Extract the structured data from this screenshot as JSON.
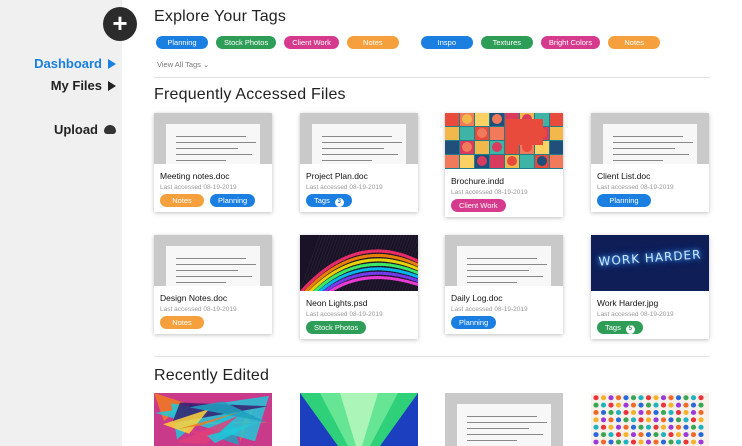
{
  "colors": {
    "blue": "#1a7fe0",
    "green": "#2e9d57",
    "pink": "#d63a8c",
    "orange": "#f5a03c"
  },
  "sidebar": {
    "add_icon": "plus-icon",
    "items": [
      {
        "label": "Dashboard",
        "icon": "play-triangle-icon",
        "active": true
      },
      {
        "label": "My Files",
        "icon": "play-triangle-icon",
        "active": false
      },
      {
        "label": "Upload",
        "icon": "cloud-upload-icon",
        "active": false
      }
    ]
  },
  "tags_section": {
    "title": "Explore Your Tags",
    "tags": [
      {
        "label": "Planning",
        "color": "blue"
      },
      {
        "label": "Stock Photos",
        "color": "green"
      },
      {
        "label": "Client Work",
        "color": "pink"
      },
      {
        "label": "Notes",
        "color": "orange"
      },
      {
        "label": "Inspo",
        "color": "blue"
      },
      {
        "label": "Textures",
        "color": "green"
      },
      {
        "label": "Bright Colors",
        "color": "pink"
      },
      {
        "label": "Notes",
        "color": "orange"
      }
    ],
    "view_all": "View All Tags"
  },
  "frequent": {
    "title": "Frequently Accessed Files",
    "files": [
      {
        "name": "Meeting notes.doc",
        "accessed": "Last accessed 08-19-2019",
        "thumb": "document",
        "tags": [
          {
            "label": "Notes",
            "color": "orange"
          },
          {
            "label": "Planning",
            "color": "blue"
          }
        ]
      },
      {
        "name": "Project Plan.doc",
        "accessed": "Last accessed 08-19-2019",
        "thumb": "document",
        "tags": [
          {
            "label": "Tags",
            "color": "blue",
            "count": "3"
          }
        ]
      },
      {
        "name": "Brochure.indd",
        "accessed": "Last accessed 08-19-2019",
        "thumb": "geometric-pattern",
        "tags": [
          {
            "label": "Client Work",
            "color": "pink"
          }
        ]
      },
      {
        "name": "Client List.doc",
        "accessed": "Last accessed 08-19-2019",
        "thumb": "document",
        "tags": [
          {
            "label": "Planning",
            "color": "blue"
          }
        ]
      },
      {
        "name": "Design Notes.doc",
        "accessed": "Last accessed 08-19-2019",
        "thumb": "document",
        "tags": [
          {
            "label": "Notes",
            "color": "orange"
          }
        ]
      },
      {
        "name": "Neon Lights.psd",
        "accessed": "Last accessed 08-19-2019",
        "thumb": "neon-rainbow",
        "tags": [
          {
            "label": "Stock Photos",
            "color": "green"
          }
        ]
      },
      {
        "name": "Daily Log.doc",
        "accessed": "Last accessed 08-19-2019",
        "thumb": "document",
        "tags": [
          {
            "label": "Planning",
            "color": "blue"
          }
        ]
      },
      {
        "name": "Work Harder.jpg",
        "accessed": "Last accessed 08-19-2019",
        "thumb": "neon-sign",
        "thumb_text": "WORK HARDER",
        "tags": [
          {
            "label": "Tags",
            "color": "green",
            "count": "5"
          }
        ]
      }
    ]
  },
  "recent": {
    "title": "Recently Edited",
    "thumbs": [
      "holographic-foil",
      "green-blue-gradient",
      "document",
      "colorful-dots"
    ]
  }
}
